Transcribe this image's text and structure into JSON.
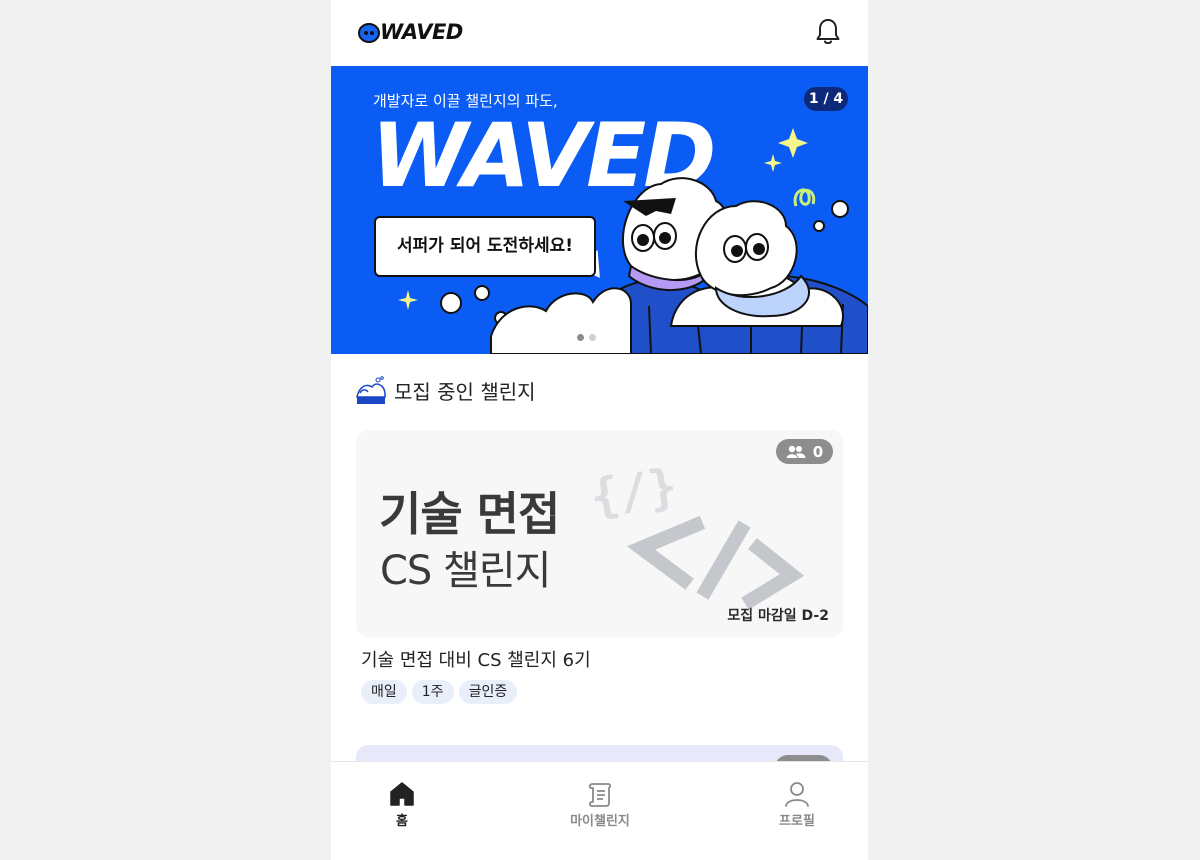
{
  "app": {
    "logo_text": "WAVED"
  },
  "banner": {
    "subtitle": "개발자로 이끌 챌린지의 파도,",
    "title": "WAVED",
    "bubble_text": "서퍼가 되어 도전하세요!",
    "counter": "1 / 4",
    "brand_color": "#0a5cf5"
  },
  "section": {
    "title": "모집 중인 챌린지",
    "icon": "wave-icon"
  },
  "challenge_card": {
    "headline": "기술 면접",
    "subline": "CS 챌린지",
    "participants": "0",
    "deadline": "모집 마감일 D-2",
    "name": "기술 면접 대비 CS 챌린지 6기",
    "tags": [
      "매일",
      "1주",
      "글인증"
    ]
  },
  "bottom_nav": {
    "items": [
      {
        "label": "홈",
        "icon": "home-icon",
        "active": true
      },
      {
        "label": "마이챌린지",
        "icon": "scroll-icon",
        "active": false
      },
      {
        "label": "프로필",
        "icon": "profile-icon",
        "active": false
      }
    ]
  }
}
